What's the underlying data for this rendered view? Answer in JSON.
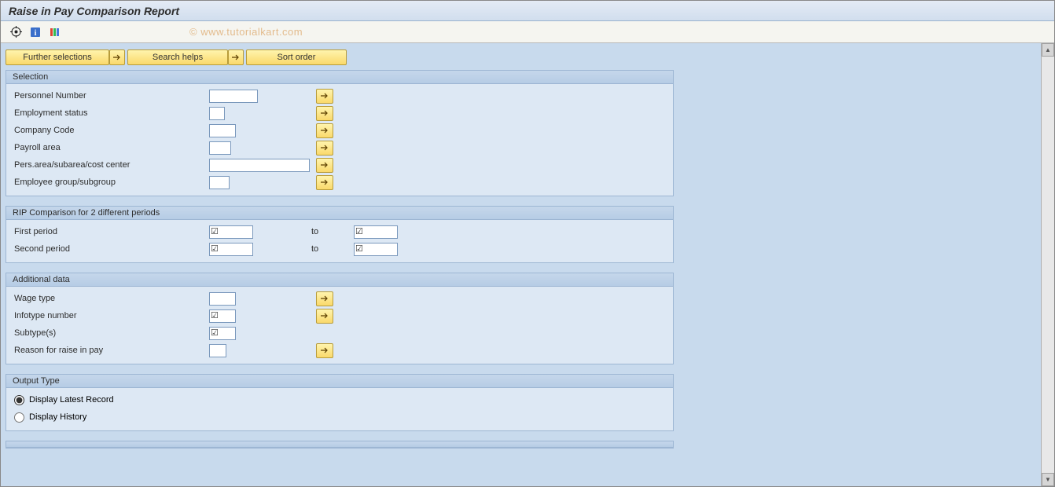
{
  "title": "Raise in Pay Comparison Report",
  "watermark": "© www.tutorialkart.com",
  "buttons": {
    "further_selections": "Further selections",
    "search_helps": "Search helps",
    "sort_order": "Sort order"
  },
  "groups": {
    "selection": {
      "title": "Selection",
      "fields": {
        "personnel_number": "Personnel Number",
        "employment_status": "Employment status",
        "company_code": "Company Code",
        "payroll_area": "Payroll area",
        "pers_area": "Pers.area/subarea/cost center",
        "employee_group": "Employee group/subgroup"
      }
    },
    "rip": {
      "title": "RIP Comparison for 2 different periods",
      "fields": {
        "first_period": "First period",
        "second_period": "Second period",
        "to": "to"
      }
    },
    "additional": {
      "title": "Additional data",
      "fields": {
        "wage_type": "Wage type",
        "infotype_number": "Infotype number",
        "subtypes": "Subtype(s)",
        "reason": "Reason for raise in pay"
      }
    },
    "output": {
      "title": "Output Type",
      "options": {
        "latest": "Display Latest Record",
        "history": "Display History"
      }
    }
  }
}
